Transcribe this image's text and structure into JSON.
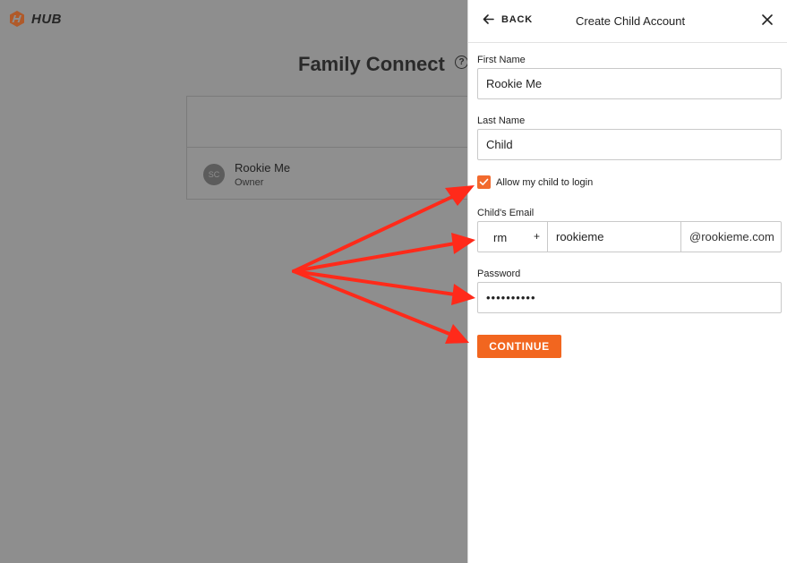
{
  "app": {
    "brand": "HUB"
  },
  "background": {
    "page_title": "Family Connect",
    "help_glyph": "?",
    "member": {
      "initials": "SC",
      "name": "Rookie Me",
      "role": "Owner"
    }
  },
  "drawer": {
    "back_label": "BACK",
    "title": "Create Child Account",
    "first_name": {
      "label": "First Name",
      "value": "Rookie Me"
    },
    "last_name": {
      "label": "Last Name",
      "value": "Child"
    },
    "allow_login": {
      "label": "Allow my child to login",
      "checked": true
    },
    "email": {
      "label": "Child's Email",
      "prefix": "rm",
      "plus": "+",
      "local": "rookieme",
      "domain": "@rookieme.com"
    },
    "password": {
      "label": "Password",
      "value": "••••••••••"
    },
    "continue_label": "CONTINUE"
  },
  "colors": {
    "accent": "#f2661f",
    "annotation_arrow": "#ff2a1a",
    "overlay": "#8f8f8f"
  },
  "icons": [
    "hub-logo-icon",
    "help-icon",
    "back-arrow-icon",
    "close-icon",
    "checkmark-icon"
  ]
}
